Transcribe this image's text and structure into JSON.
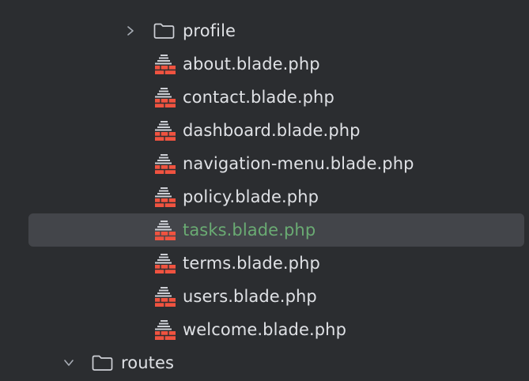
{
  "tree": {
    "folders": {
      "profile": {
        "label": "profile",
        "expanded": false,
        "icon": "folder-icon",
        "chevron": "chevron-right-icon"
      },
      "routes": {
        "label": "routes",
        "expanded": true,
        "icon": "folder-icon",
        "chevron": "chevron-down-icon"
      }
    },
    "files": [
      {
        "label": "about.blade.php",
        "icon": "blade-file-icon"
      },
      {
        "label": "contact.blade.php",
        "icon": "blade-file-icon"
      },
      {
        "label": "dashboard.blade.php",
        "icon": "blade-file-icon"
      },
      {
        "label": "navigation-menu.blade.php",
        "icon": "blade-file-icon"
      },
      {
        "label": "policy.blade.php",
        "icon": "blade-file-icon"
      },
      {
        "label": "tasks.blade.php",
        "icon": "blade-file-icon",
        "selected": true
      },
      {
        "label": "terms.blade.php",
        "icon": "blade-file-icon"
      },
      {
        "label": "users.blade.php",
        "icon": "blade-file-icon"
      },
      {
        "label": "welcome.blade.php",
        "icon": "blade-file-icon"
      }
    ]
  },
  "colors": {
    "background": "#2b2d30",
    "text": "#dfe1e5",
    "selected_text": "#6aab73",
    "selection_bg": "#43454a",
    "blade_icon": "#f05340"
  }
}
